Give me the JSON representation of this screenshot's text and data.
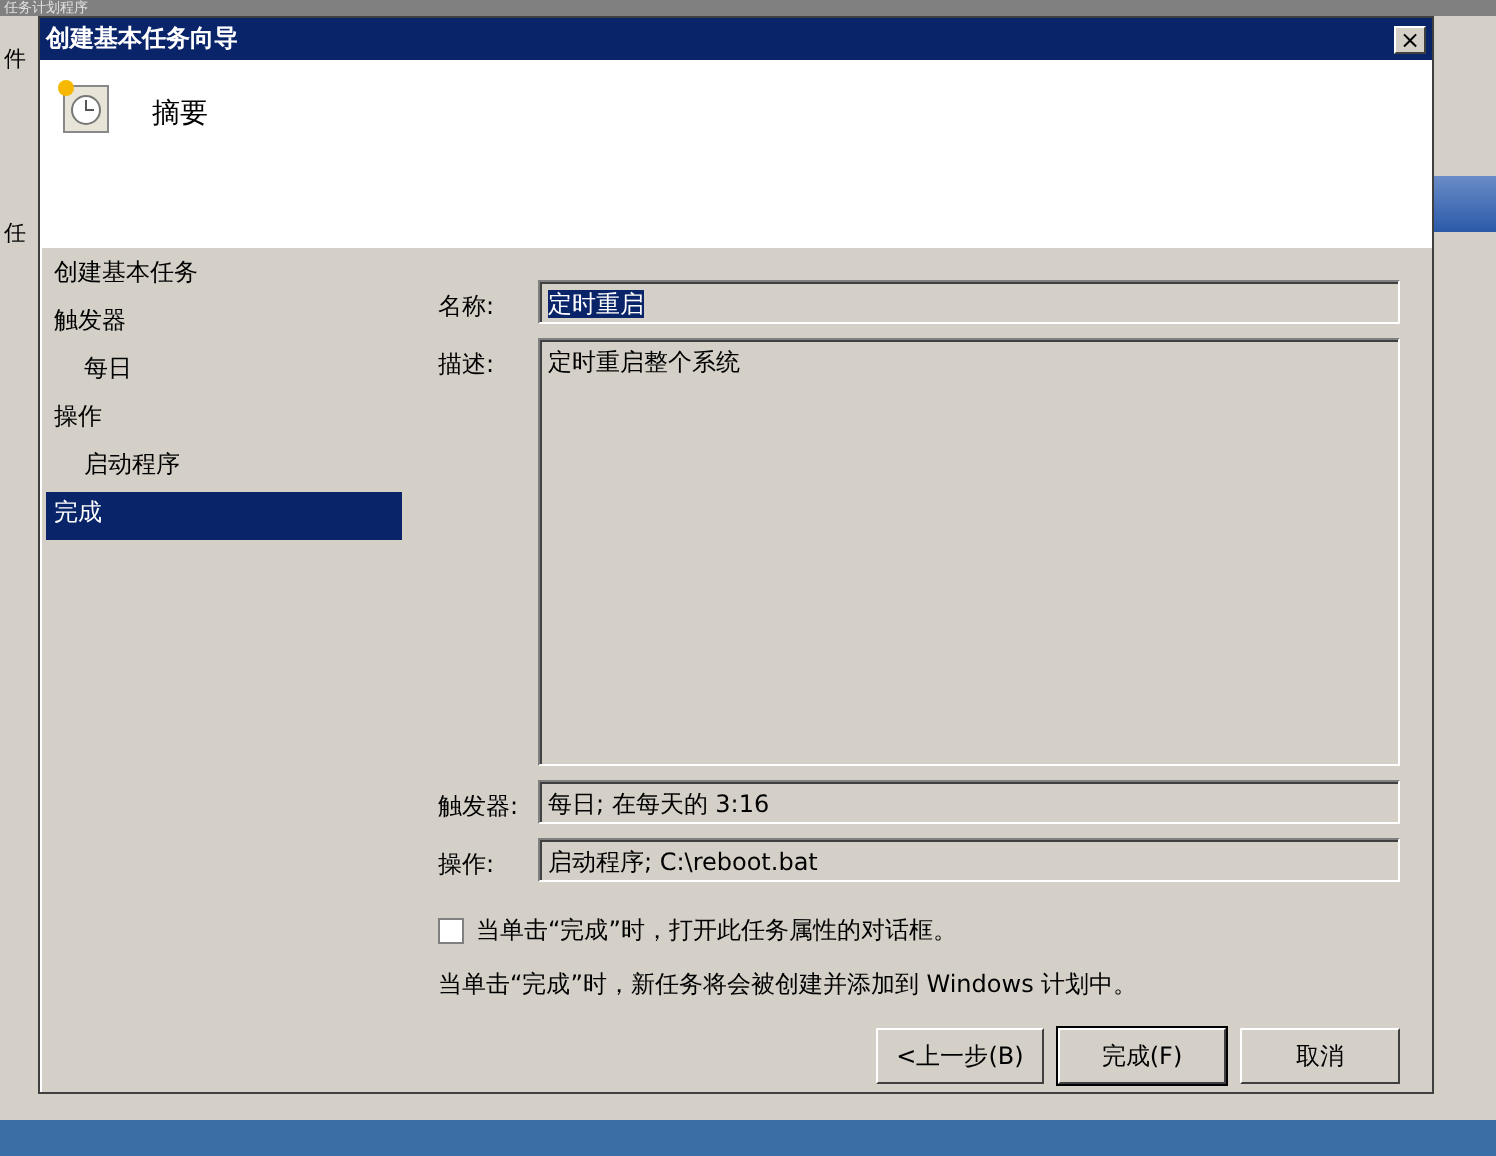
{
  "background_window": {
    "title": "任务计划程序",
    "menu_fragment": "件",
    "pane_fragment": "任"
  },
  "dialog": {
    "title": "创建基本任务向导",
    "close_glyph": "×",
    "heading": "摘要"
  },
  "steps": [
    {
      "label": "创建基本任务",
      "indented": false,
      "selected": false
    },
    {
      "label": "触发器",
      "indented": false,
      "selected": false
    },
    {
      "label": "每日",
      "indented": true,
      "selected": false
    },
    {
      "label": "操作",
      "indented": false,
      "selected": false
    },
    {
      "label": "启动程序",
      "indented": true,
      "selected": false
    },
    {
      "label": "完成",
      "indented": false,
      "selected": true
    }
  ],
  "fields": [
    {
      "label": "名称:",
      "value": "定时重启",
      "kind": "name"
    },
    {
      "label": "描述:",
      "value": "定时重启整个系统",
      "kind": "multiline"
    },
    {
      "label": "触发器:",
      "value": "每日; 在每天的 3:16",
      "kind": "line"
    },
    {
      "label": "操作:",
      "value": "启动程序; C:\\reboot.bat",
      "kind": "line"
    }
  ],
  "open_properties": {
    "label": "当单击“完成”时，打开此任务属性的对话框。",
    "checked": false
  },
  "info": "当单击“完成”时，新任务将会被创建并添加到 Windows 计划中。",
  "buttons": [
    {
      "label": "<上一步(B)",
      "default": false
    },
    {
      "label": "完成(F)",
      "default": true
    },
    {
      "label": "取消",
      "default": false
    }
  ]
}
